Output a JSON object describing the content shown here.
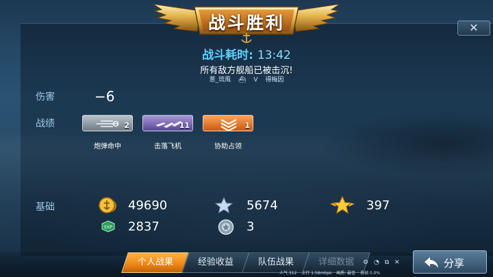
{
  "banner": {
    "title": "战斗胜利"
  },
  "close": {
    "label": "✕"
  },
  "summary": {
    "time_label": "战斗耗时:",
    "time_value": "13:42",
    "message": "所有敌方舰船已被击沉!",
    "player_left": "葱_琉風",
    "vs": "V",
    "player_right": "得梅因"
  },
  "damage": {
    "label": "伤害",
    "value": "−6"
  },
  "achievements": {
    "label": "战绩",
    "items": [
      {
        "name": "炮弹命中",
        "count": "2",
        "color": "#8a96a1"
      },
      {
        "name": "击落飞机",
        "count": "11",
        "color": "#7766b6"
      },
      {
        "name": "协助占领",
        "count": "1",
        "color": "#e67a2c"
      }
    ]
  },
  "base": {
    "label": "基础",
    "gold": "49690",
    "exp": "2837",
    "silver_star": "5674",
    "gold_star": "397",
    "medal": "3",
    "icons": [
      "gold-coin-icon",
      "exp-icon",
      "silver-star-icon",
      "medal-icon",
      "gold-star-icon"
    ]
  },
  "tabs": [
    {
      "label": "个人战果",
      "active": true
    },
    {
      "label": "经验收益",
      "active": false
    },
    {
      "label": "队伍战果",
      "active": false
    },
    {
      "label": "详细数据",
      "active": false
    }
  ],
  "share": {
    "label": "分享"
  },
  "status_bar": {
    "popularity": "人气 312",
    "upload": "上行 1.58mbps",
    "quality": "画质: 最佳",
    "loss": "丢帧 0.0%"
  },
  "colors": {
    "accent": "#f08a17",
    "title_blue": "#5ed0ff"
  }
}
